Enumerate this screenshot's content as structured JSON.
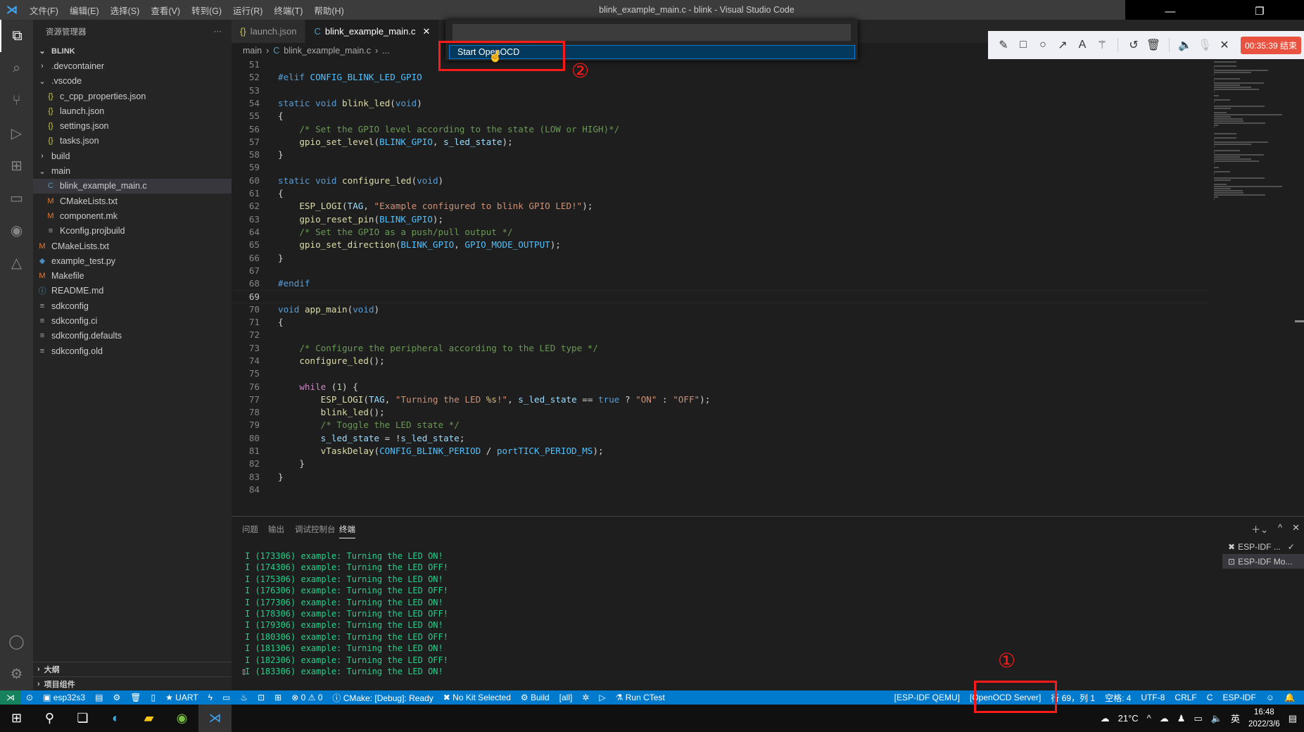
{
  "titlebar": {
    "title": "blink_example_main.c - blink - Visual Studio Code",
    "menu": [
      "文件(F)",
      "编辑(E)",
      "选择(S)",
      "查看(V)",
      "转到(G)",
      "运行(R)",
      "终端(T)",
      "帮助(H)"
    ]
  },
  "sidebar": {
    "title": "资源管理器",
    "more": "···",
    "root": "BLINK",
    "items": [
      {
        "label": ".devcontainer",
        "icon": "›",
        "level": 1
      },
      {
        "label": ".vscode",
        "icon": "⌄",
        "level": 1
      },
      {
        "label": "c_cpp_properties.json",
        "icon": "{}",
        "level": 2
      },
      {
        "label": "launch.json",
        "icon": "{}",
        "level": 2
      },
      {
        "label": "settings.json",
        "icon": "{}",
        "level": 2
      },
      {
        "label": "tasks.json",
        "icon": "{}",
        "level": 2
      },
      {
        "label": "build",
        "icon": "›",
        "level": 1
      },
      {
        "label": "main",
        "icon": "⌄",
        "level": 1
      },
      {
        "label": "blink_example_main.c",
        "icon": "C",
        "level": 2,
        "selected": true
      },
      {
        "label": "CMakeLists.txt",
        "icon": "M",
        "level": 2
      },
      {
        "label": "component.mk",
        "icon": "M",
        "level": 2
      },
      {
        "label": "Kconfig.projbuild",
        "icon": "≡",
        "level": 2
      },
      {
        "label": "CMakeLists.txt",
        "icon": "M",
        "level": 1
      },
      {
        "label": "example_test.py",
        "icon": "◆",
        "level": 1
      },
      {
        "label": "Makefile",
        "icon": "M",
        "level": 1
      },
      {
        "label": "README.md",
        "icon": "ⓘ",
        "level": 1
      },
      {
        "label": "sdkconfig",
        "icon": "≡",
        "level": 1
      },
      {
        "label": "sdkconfig.ci",
        "icon": "≡",
        "level": 1
      },
      {
        "label": "sdkconfig.defaults",
        "icon": "≡",
        "level": 1
      },
      {
        "label": "sdkconfig.old",
        "icon": "≡",
        "level": 1
      }
    ],
    "outline": "大纲",
    "project": "项目组件"
  },
  "tabs": [
    {
      "label": "launch.json",
      "icon": "{}"
    },
    {
      "label": "blink_example_main.c",
      "icon": "C",
      "active": true,
      "close": "✕"
    }
  ],
  "breadcrumb": [
    "main",
    "›",
    "C",
    "blink_example_main.c",
    "›",
    "..."
  ],
  "quickpick": {
    "item": "Start OpenOCD"
  },
  "annotations": {
    "one": "①",
    "two": "②"
  },
  "recorder": {
    "timer": "00:35:39 结束"
  },
  "editor": {
    "current_line": 69,
    "lines": [
      {
        "n": 51,
        "t": []
      },
      {
        "n": 52,
        "t": [
          [
            "kw",
            "#elif"
          ],
          [
            "mac",
            " CONFIG_BLINK_LED_GPIO"
          ]
        ]
      },
      {
        "n": 53,
        "t": []
      },
      {
        "n": 54,
        "t": [
          [
            "kw",
            "static"
          ],
          [
            "pl",
            " "
          ],
          [
            "kw",
            "void"
          ],
          [
            "pl",
            " "
          ],
          [
            "fn",
            "blink_led"
          ],
          [
            "pl",
            "("
          ],
          [
            "kw",
            "void"
          ],
          [
            "pl",
            ")"
          ]
        ]
      },
      {
        "n": 55,
        "t": [
          [
            "pl",
            "{"
          ]
        ]
      },
      {
        "n": 56,
        "t": [
          [
            "pl",
            "    "
          ],
          [
            "cm",
            "/* Set the GPIO level according to the state (LOW or HIGH)*/"
          ]
        ]
      },
      {
        "n": 57,
        "t": [
          [
            "pl",
            "    "
          ],
          [
            "fn",
            "gpio_set_level"
          ],
          [
            "pl",
            "("
          ],
          [
            "mac",
            "BLINK_GPIO"
          ],
          [
            "pl",
            ", "
          ],
          [
            "var",
            "s_led_state"
          ],
          [
            "pl",
            ");"
          ]
        ]
      },
      {
        "n": 58,
        "t": [
          [
            "pl",
            "}"
          ]
        ]
      },
      {
        "n": 59,
        "t": []
      },
      {
        "n": 60,
        "t": [
          [
            "kw",
            "static"
          ],
          [
            "pl",
            " "
          ],
          [
            "kw",
            "void"
          ],
          [
            "pl",
            " "
          ],
          [
            "fn",
            "configure_led"
          ],
          [
            "pl",
            "("
          ],
          [
            "kw",
            "void"
          ],
          [
            "pl",
            ")"
          ]
        ]
      },
      {
        "n": 61,
        "t": [
          [
            "pl",
            "{"
          ]
        ]
      },
      {
        "n": 62,
        "t": [
          [
            "pl",
            "    "
          ],
          [
            "fn",
            "ESP_LOGI"
          ],
          [
            "pl",
            "("
          ],
          [
            "var",
            "TAG"
          ],
          [
            "pl",
            ", "
          ],
          [
            "st",
            "\"Example configured to blink GPIO LED!\""
          ],
          [
            "pl",
            ");"
          ]
        ]
      },
      {
        "n": 63,
        "t": [
          [
            "pl",
            "    "
          ],
          [
            "fn",
            "gpio_reset_pin"
          ],
          [
            "pl",
            "("
          ],
          [
            "mac",
            "BLINK_GPIO"
          ],
          [
            "pl",
            ");"
          ]
        ]
      },
      {
        "n": 64,
        "t": [
          [
            "pl",
            "    "
          ],
          [
            "cm",
            "/* Set the GPIO as a push/pull output */"
          ]
        ]
      },
      {
        "n": 65,
        "t": [
          [
            "pl",
            "    "
          ],
          [
            "fn",
            "gpio_set_direction"
          ],
          [
            "pl",
            "("
          ],
          [
            "mac",
            "BLINK_GPIO"
          ],
          [
            "pl",
            ", "
          ],
          [
            "mac",
            "GPIO_MODE_OUTPUT"
          ],
          [
            "pl",
            ");"
          ]
        ]
      },
      {
        "n": 66,
        "t": [
          [
            "pl",
            "}"
          ]
        ]
      },
      {
        "n": 67,
        "t": []
      },
      {
        "n": 68,
        "t": [
          [
            "kw",
            "#endif"
          ]
        ]
      },
      {
        "n": 69,
        "t": []
      },
      {
        "n": 70,
        "t": [
          [
            "kw",
            "void"
          ],
          [
            "pl",
            " "
          ],
          [
            "fn",
            "app_main"
          ],
          [
            "pl",
            "("
          ],
          [
            "kw",
            "void"
          ],
          [
            "pl",
            ")"
          ]
        ]
      },
      {
        "n": 71,
        "t": [
          [
            "pl",
            "{"
          ]
        ]
      },
      {
        "n": 72,
        "t": []
      },
      {
        "n": 73,
        "t": [
          [
            "pl",
            "    "
          ],
          [
            "cm",
            "/* Configure the peripheral according to the LED type */"
          ]
        ]
      },
      {
        "n": 74,
        "t": [
          [
            "pl",
            "    "
          ],
          [
            "fn",
            "configure_led"
          ],
          [
            "pl",
            "();"
          ]
        ]
      },
      {
        "n": 75,
        "t": []
      },
      {
        "n": 76,
        "t": [
          [
            "pl",
            "    "
          ],
          [
            "ctl",
            "while"
          ],
          [
            "pl",
            " ("
          ],
          [
            "num",
            "1"
          ],
          [
            "pl",
            ") {"
          ]
        ]
      },
      {
        "n": 77,
        "t": [
          [
            "pl",
            "        "
          ],
          [
            "fn",
            "ESP_LOGI"
          ],
          [
            "pl",
            "("
          ],
          [
            "var",
            "TAG"
          ],
          [
            "pl",
            ", "
          ],
          [
            "st",
            "\"Turning the LED "
          ],
          [
            "es",
            "%s"
          ],
          [
            "st",
            "!\""
          ],
          [
            "pl",
            ", "
          ],
          [
            "var",
            "s_led_state"
          ],
          [
            "pl",
            " == "
          ],
          [
            "kw",
            "true"
          ],
          [
            "pl",
            " ? "
          ],
          [
            "st",
            "\"ON\""
          ],
          [
            "pl",
            " : "
          ],
          [
            "st",
            "\"OFF\""
          ],
          [
            "pl",
            ");"
          ]
        ]
      },
      {
        "n": 78,
        "t": [
          [
            "pl",
            "        "
          ],
          [
            "fn",
            "blink_led"
          ],
          [
            "pl",
            "();"
          ]
        ]
      },
      {
        "n": 79,
        "t": [
          [
            "pl",
            "        "
          ],
          [
            "cm",
            "/* Toggle the LED state */"
          ]
        ]
      },
      {
        "n": 80,
        "t": [
          [
            "pl",
            "        "
          ],
          [
            "var",
            "s_led_state"
          ],
          [
            "pl",
            " = !"
          ],
          [
            "var",
            "s_led_state"
          ],
          [
            "pl",
            ";"
          ]
        ]
      },
      {
        "n": 81,
        "t": [
          [
            "pl",
            "        "
          ],
          [
            "fn",
            "vTaskDelay"
          ],
          [
            "pl",
            "("
          ],
          [
            "mac",
            "CONFIG_BLINK_PERIOD"
          ],
          [
            "pl",
            " / "
          ],
          [
            "mac",
            "portTICK_PERIOD_MS"
          ],
          [
            "pl",
            ");"
          ]
        ]
      },
      {
        "n": 82,
        "t": [
          [
            "pl",
            "    }"
          ]
        ]
      },
      {
        "n": 83,
        "t": [
          [
            "pl",
            "}"
          ]
        ]
      },
      {
        "n": 84,
        "t": []
      }
    ]
  },
  "panel": {
    "tabs": [
      "问题",
      "输出",
      "调试控制台",
      "终端"
    ],
    "active_tab": "终端",
    "terminal": [
      "I (173306) example: Turning the LED ON!",
      "I (174306) example: Turning the LED OFF!",
      "I (175306) example: Turning the LED ON!",
      "I (176306) example: Turning the LED OFF!",
      "I (177306) example: Turning the LED ON!",
      "I (178306) example: Turning the LED OFF!",
      "I (179306) example: Turning the LED ON!",
      "I (180306) example: Turning the LED OFF!",
      "I (181306) example: Turning the LED ON!",
      "I (182306) example: Turning the LED OFF!",
      "I (183306) example: Turning the LED ON!"
    ],
    "terminals": [
      {
        "label": "ESP-IDF ...",
        "check": "✓"
      },
      {
        "label": "ESP-IDF Mo..."
      }
    ]
  },
  "statusbar": {
    "left": [
      "esp32s3",
      "UART",
      "⊗ 0 ⚠ 0",
      "ⓘ CMake: [Debug]: Ready",
      "No Kit Selected",
      "Build",
      "[all]",
      "Run CTest"
    ],
    "right": [
      "[ESP-IDF QEMU]",
      "[OpenOCD Server]",
      "行 69，列 1",
      "空格: 4",
      "UTF-8",
      "CRLF",
      "C",
      "ESP-IDF"
    ]
  },
  "taskbar": {
    "weather": "21°C",
    "ime": "英",
    "time": "16:48",
    "date": "2022/3/6"
  },
  "colors": {
    "statusbar": "#007acc",
    "annotation": "#ff1a1a",
    "terminal_text": "#23d18b"
  }
}
